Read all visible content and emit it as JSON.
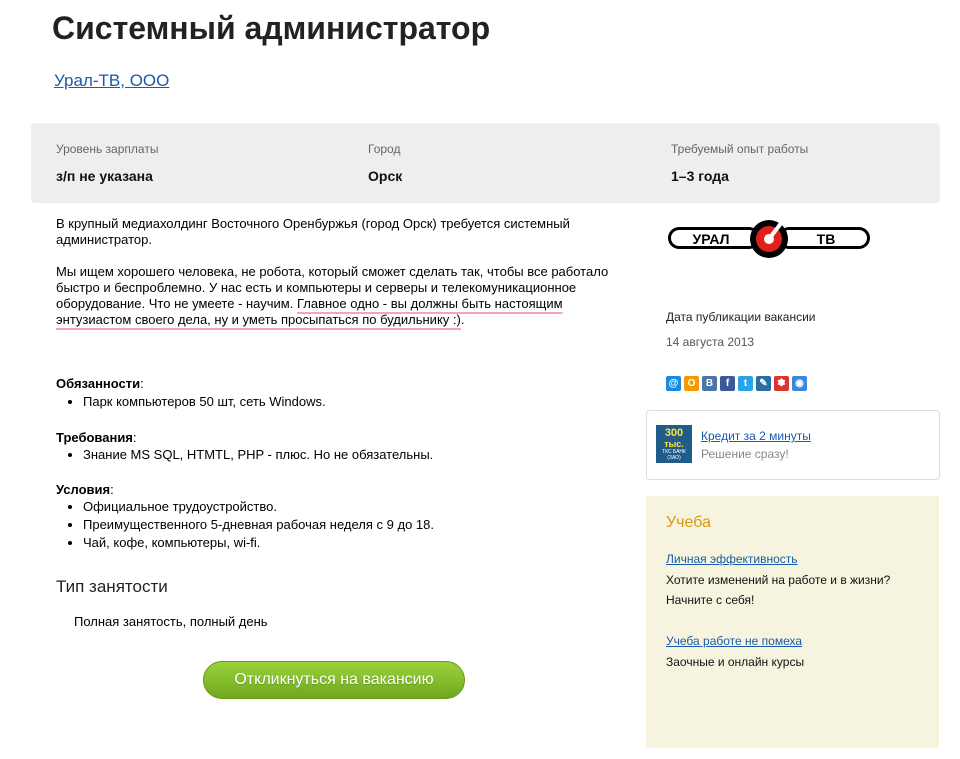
{
  "title": "Системный администратор",
  "company": "Урал-ТВ, ООО",
  "info": {
    "salary_label": "Уровень зарплаты",
    "salary_value": "з/п не указана",
    "city_label": "Город",
    "city_value": "Орск",
    "experience_label": "Требуемый опыт работы",
    "experience_value": "1–3 года"
  },
  "description": {
    "p1": "В крупный медиахолдинг Восточного Оренбуржья (город Орск) требуется системный администратор.",
    "p2_plain": "Мы ищем хорошего человека, не робота, который сможет сделать так, чтобы все работало быстро и беспроблемно. У нас есть и компьютеры и серверы и телекомуникационное оборудование. Что не умеете - научим. ",
    "p2_highlight": "Главное одно - вы должны быть настоящим энтузиастом своего дела, ну и уметь просыпаться по будильнику :)",
    "p2_end": "."
  },
  "sections": {
    "duties_title": "Обязанности",
    "duties": [
      "Парк компьютеров 50 шт, сеть Windows."
    ],
    "requirements_title": "Требования",
    "requirements": [
      "Знание MS SQL, HTMTL, PHP - плюс. Но не обязательны."
    ],
    "conditions_title": "Условия",
    "conditions": [
      "Официальное трудоустройство.",
      "Преимущественного 5-дневная рабочая неделя с 9 до 18.",
      "Чай, кофе, компьютеры, wi-fi."
    ],
    "colon": ":"
  },
  "employment": {
    "title": "Тип занятости",
    "value": "Полная занятость, полный день"
  },
  "apply_label": "Откликнуться на вакансию",
  "logo": {
    "left": "УРАЛ",
    "right": "ТВ"
  },
  "pubdate": {
    "label": "Дата публикации вакансии",
    "value": "14 августа 2013"
  },
  "share_icons": [
    {
      "name": "mail-icon",
      "glyph": "@",
      "color": "#168de2"
    },
    {
      "name": "odnoklassniki-icon",
      "glyph": "О",
      "color": "#f59a00"
    },
    {
      "name": "vkontakte-icon",
      "glyph": "В",
      "color": "#4a76a8"
    },
    {
      "name": "facebook-icon",
      "glyph": "f",
      "color": "#3b5998"
    },
    {
      "name": "twitter-icon",
      "glyph": "t",
      "color": "#2aa3ef"
    },
    {
      "name": "livejournal-icon",
      "glyph": "✎",
      "color": "#2b6ea6"
    },
    {
      "name": "moikrug-icon",
      "glyph": "✽",
      "color": "#e0332e"
    },
    {
      "name": "ya-ru-icon",
      "glyph": "◉",
      "color": "#3a88d8"
    }
  ],
  "ad": {
    "badge_line1": "300",
    "badge_line2": "тыс.",
    "badge_line3": "ТКС БАНК (ЗАО)",
    "link": "Кредит за 2 минуты",
    "sub": "Решение сразу!"
  },
  "education": {
    "title": "Учеба",
    "link1": "Личная эффективность",
    "text1": "Хотите изменений на работе и в жизни? Начните с себя!",
    "link2": "Учеба работе не помеха",
    "text2": "Заочные и онлайн курсы"
  },
  "colors": {
    "link": "#1a5bad",
    "accent_green": "#7fb829",
    "highlight_underline": "#f5a3c4",
    "edu_bg": "#f6f4de",
    "edu_title": "#d79a12",
    "logo_red": "#e0211b"
  }
}
